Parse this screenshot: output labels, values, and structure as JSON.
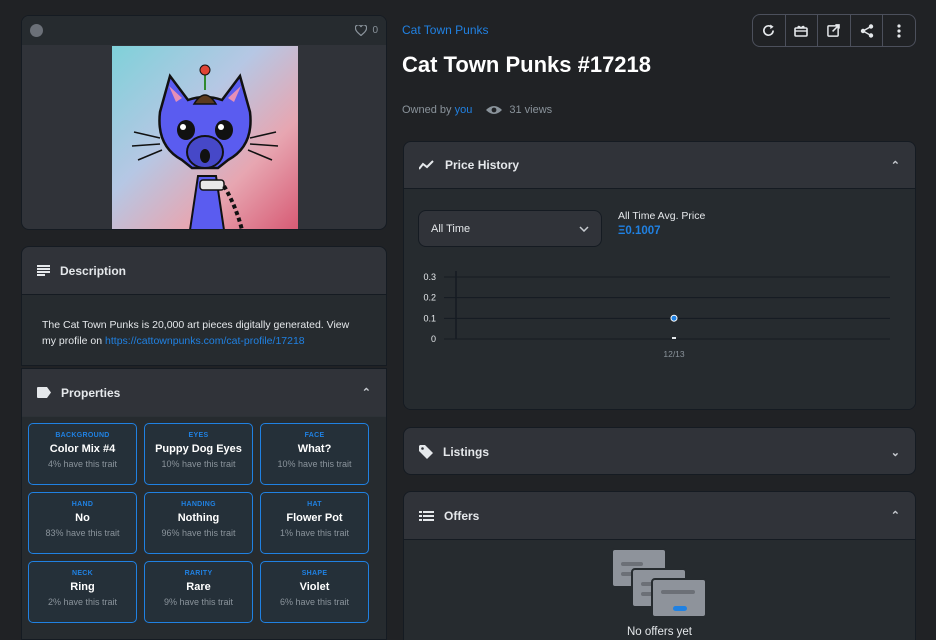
{
  "image_card": {
    "favorite_count": "0"
  },
  "description": {
    "title": "Description",
    "text": "The Cat Town Punks is 20,000 art pieces digitally generated. View my profile on",
    "link": "https://cattownpunks.com/cat-profile/17218"
  },
  "properties": {
    "title": "Properties",
    "traits": [
      {
        "type": "BACKGROUND",
        "value": "Color Mix #4",
        "rarity": "4% have this trait"
      },
      {
        "type": "EYES",
        "value": "Puppy Dog Eyes",
        "rarity": "10% have this trait"
      },
      {
        "type": "FACE",
        "value": "What?",
        "rarity": "10% have this trait"
      },
      {
        "type": "HAND",
        "value": "No",
        "rarity": "83% have this trait"
      },
      {
        "type": "HANDING",
        "value": "Nothing",
        "rarity": "96% have this trait"
      },
      {
        "type": "HAT",
        "value": "Flower Pot",
        "rarity": "1% have this trait"
      },
      {
        "type": "NECK",
        "value": "Ring",
        "rarity": "2% have this trait"
      },
      {
        "type": "RARITY",
        "value": "Rare",
        "rarity": "9% have this trait"
      },
      {
        "type": "SHAPE",
        "value": "Violet",
        "rarity": "6% have this trait"
      }
    ]
  },
  "header": {
    "collection": "Cat Town Punks",
    "title": "Cat Town Punks #17218",
    "owned_by": "Owned by",
    "owner": "you",
    "views": "31 views"
  },
  "actions": [
    "refresh-icon",
    "gift-icon",
    "external-link-icon",
    "share-icon",
    "more-icon"
  ],
  "price_history": {
    "title": "Price History",
    "range": "All Time",
    "avg_label": "All Time Avg. Price",
    "avg_value": "Ξ0.1007"
  },
  "chart_data": {
    "type": "scatter",
    "x": [
      "12/13"
    ],
    "y_ticks": [
      "0.3",
      "0.2",
      "0.1",
      "0"
    ],
    "ylim": [
      0,
      0.3
    ],
    "series": [
      {
        "values": [
          0.1007
        ]
      }
    ],
    "grid": true
  },
  "listings": {
    "title": "Listings"
  },
  "offers": {
    "title": "Offers",
    "empty": "No offers yet"
  },
  "colors": {
    "accent": "#2081e2",
    "background": "#202225",
    "panel": "#303339"
  }
}
